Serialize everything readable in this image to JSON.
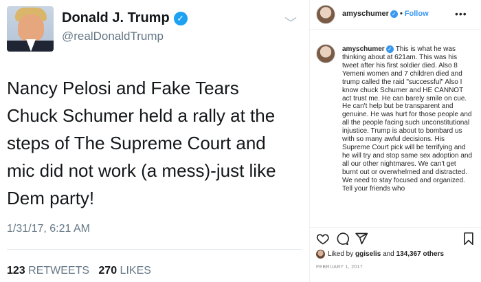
{
  "tweet": {
    "name": "Donald J. Trump",
    "handle": "@realDonaldTrump",
    "body": "Nancy Pelosi and Fake Tears\nChuck Schumer held a rally  at the\nsteps of The Supreme Court and\nmic did not work (a mess)-just like\nDem party!",
    "date": "1/31/17, 6:21 AM",
    "retweets_count": "123",
    "retweets_label": "RETWEETS",
    "likes_count": "270",
    "likes_label": "LIKES"
  },
  "instagram": {
    "username": "amyschumer",
    "follow_label": "Follow",
    "more_label": "•••",
    "caption_user": "amyschumer",
    "caption_text": "This is what he was thinking about at 621am. This was his tweet after his first soldier died. Also 8 Yemeni women and 7 children died and trump called the raid \"successful\" Also I know chuck Schumer and HE CANNOT act trust me. He can barely smile on cue. He can't help but be transparent and genuine. He was hurt for those people and all the people facing such unconstitutional injustice. Trump is about to bombard us with so many awful decisions. His Supreme Court pick will be terrifying and he will try and stop same sex adoption and all our other nightmares. We can't get burnt out or overwhelmed and distracted. We need to stay focused and organized. Tell your friends who",
    "likes_prefix": "Liked by",
    "likes_user": "ggiselis",
    "likes_and": "and",
    "likes_others": "134,367 others",
    "date": "FEBRUARY 1, 2017"
  },
  "colors": {
    "twitter_blue": "#1da1f2",
    "instagram_blue": "#3897f0",
    "text_dark": "#14171a",
    "text_gray": "#657786"
  }
}
